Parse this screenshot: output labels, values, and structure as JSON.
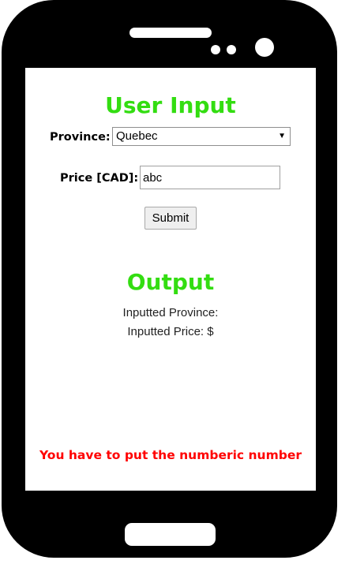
{
  "form": {
    "title": "User Input",
    "province_label": "Province:",
    "province_selected": "Quebec",
    "price_label": "Price [CAD]:",
    "price_value": "abc",
    "submit_label": "Submit"
  },
  "output": {
    "title": "Output",
    "province_line": "Inputted Province:",
    "price_line": "Inputted Price: $"
  },
  "error": {
    "message": "You have to put the numberic number"
  },
  "colors": {
    "heading": "#33dd11",
    "error": "#ff0000",
    "phone_frame": "#000000"
  }
}
